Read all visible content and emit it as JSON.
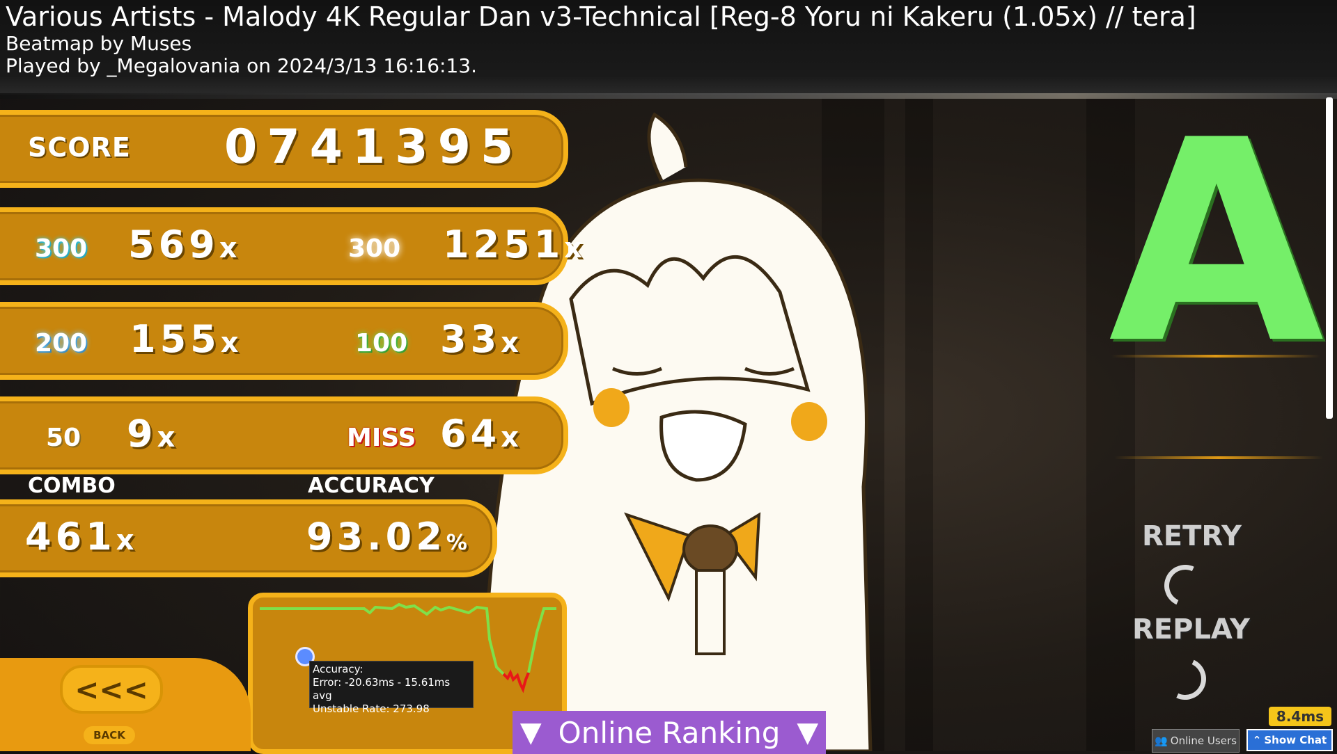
{
  "header": {
    "title": "Various Artists - Malody 4K Regular Dan v3-Technical [Reg-8 Yoru ni Kakeru (1.05x) // tera]",
    "mapper": "Beatmap by Muses",
    "played": "Played by _Megalovania on 2024/3/13 16:16:13."
  },
  "score": {
    "label": "SCORE",
    "value": "0741395"
  },
  "judgements": {
    "max300": {
      "icon": "300",
      "count": "569",
      "x": "x"
    },
    "great300": {
      "icon": "300",
      "count": "1251",
      "x": "x"
    },
    "good200": {
      "icon": "200",
      "count": "155",
      "x": "x"
    },
    "ok100": {
      "icon": "100",
      "count": "33",
      "x": "x"
    },
    "meh50": {
      "icon": "50",
      "count": "9",
      "x": "x"
    },
    "miss": {
      "icon": "MISS",
      "count": "64",
      "x": "x"
    }
  },
  "combo": {
    "label": "COMBO",
    "value": "461",
    "x": "x"
  },
  "accuracy": {
    "label": "ACCURACY",
    "value": "93.02",
    "unit": "%"
  },
  "graph_tooltip": {
    "line1": "Accuracy:",
    "line2": "Error: -20.63ms - 15.61ms avg",
    "line3": "Unstable Rate: 273.98"
  },
  "back": {
    "arrows": "<<<",
    "label": "BACK"
  },
  "grade": {
    "letter": "A",
    "color": "#75ef69"
  },
  "actions": {
    "retry": "RETRY",
    "replay": "REPLAY"
  },
  "online_ranking": {
    "label": "Online Ranking"
  },
  "footer": {
    "fps": "8.4ms",
    "online_users": "Online Users",
    "show_chat": "Show Chat"
  },
  "colors": {
    "panel": "#c8860d",
    "panel_border": "#f5b21a",
    "ranking_bar": "#9b5bd0"
  }
}
